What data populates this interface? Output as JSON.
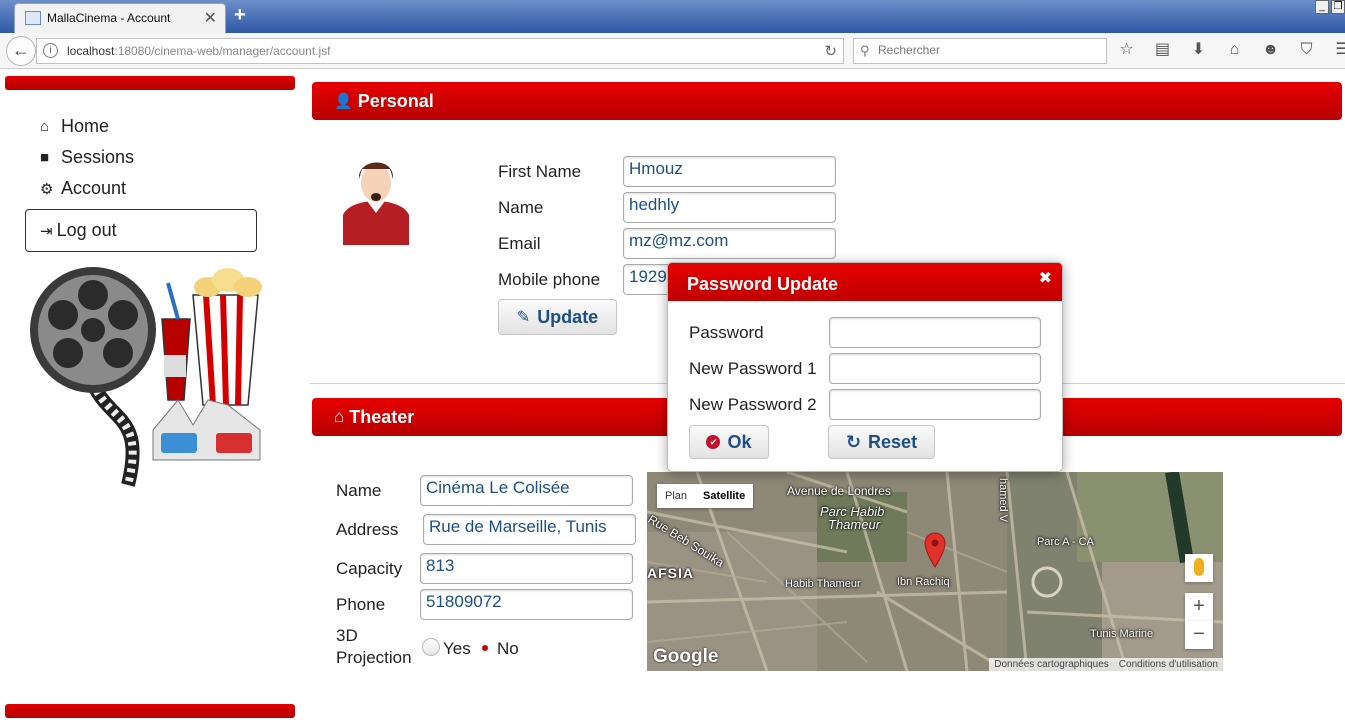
{
  "browser": {
    "tab_title": "MallaCinema - Account",
    "url_host": "localhost",
    "url_path": ":18080/cinema-web/manager/account.jsf",
    "search_placeholder": "Rechercher"
  },
  "sidebar": {
    "items": [
      {
        "label": "Home",
        "icon": "home-icon"
      },
      {
        "label": "Sessions",
        "icon": "video-camera-icon"
      },
      {
        "label": "Account",
        "icon": "gear-icon"
      }
    ],
    "logout_label": "Log out"
  },
  "personal": {
    "title": "Personal",
    "first_name_label": "First Name",
    "first_name": "Hmouz",
    "name_label": "Name",
    "name": "hedhly",
    "email_label": "Email",
    "email": "mz@mz.com",
    "mobile_label": "Mobile phone",
    "mobile": "19292",
    "update_label": "Update"
  },
  "theater": {
    "title": "Theater",
    "name_label": "Name",
    "name": "Cinéma Le Colisée",
    "address_label": "Address",
    "address": "Rue de Marseille, Tunis",
    "capacity_label": "Capacity",
    "capacity": "813",
    "phone_label": "Phone",
    "phone": "51809072",
    "projection_label_1": "3D",
    "projection_label_2": "Projection",
    "yes_label": "Yes",
    "no_label": "No",
    "projection_selected": "No"
  },
  "map": {
    "type_plan": "Plan",
    "type_satellite": "Satellite",
    "selected_type": "Satellite",
    "labels": {
      "avenue_londres": "Avenue de Londres",
      "parc_habib": "Parc Habib",
      "thameur": "Thameur",
      "beb_souika": "Rue Beb Souika",
      "hafsia": "AFSIA",
      "habib_thameur": "Habib Thameur",
      "ibn_rachiq": "Ibn Rachiq",
      "parc_a": "Parc A - CA",
      "tunis_marine": "Tunis Marine",
      "mohamed_v": "hamed V"
    },
    "google": "Google",
    "footer_data": "Données cartographiques",
    "footer_terms": "Conditions d'utilisation"
  },
  "dialog": {
    "title": "Password Update",
    "password_label": "Password",
    "new1_label": "New Password 1",
    "new2_label": "New Password 2",
    "ok_label": "Ok",
    "reset_label": "Reset"
  },
  "colors": {
    "accent": "#cc0000",
    "field_text": "#1d4f86"
  }
}
